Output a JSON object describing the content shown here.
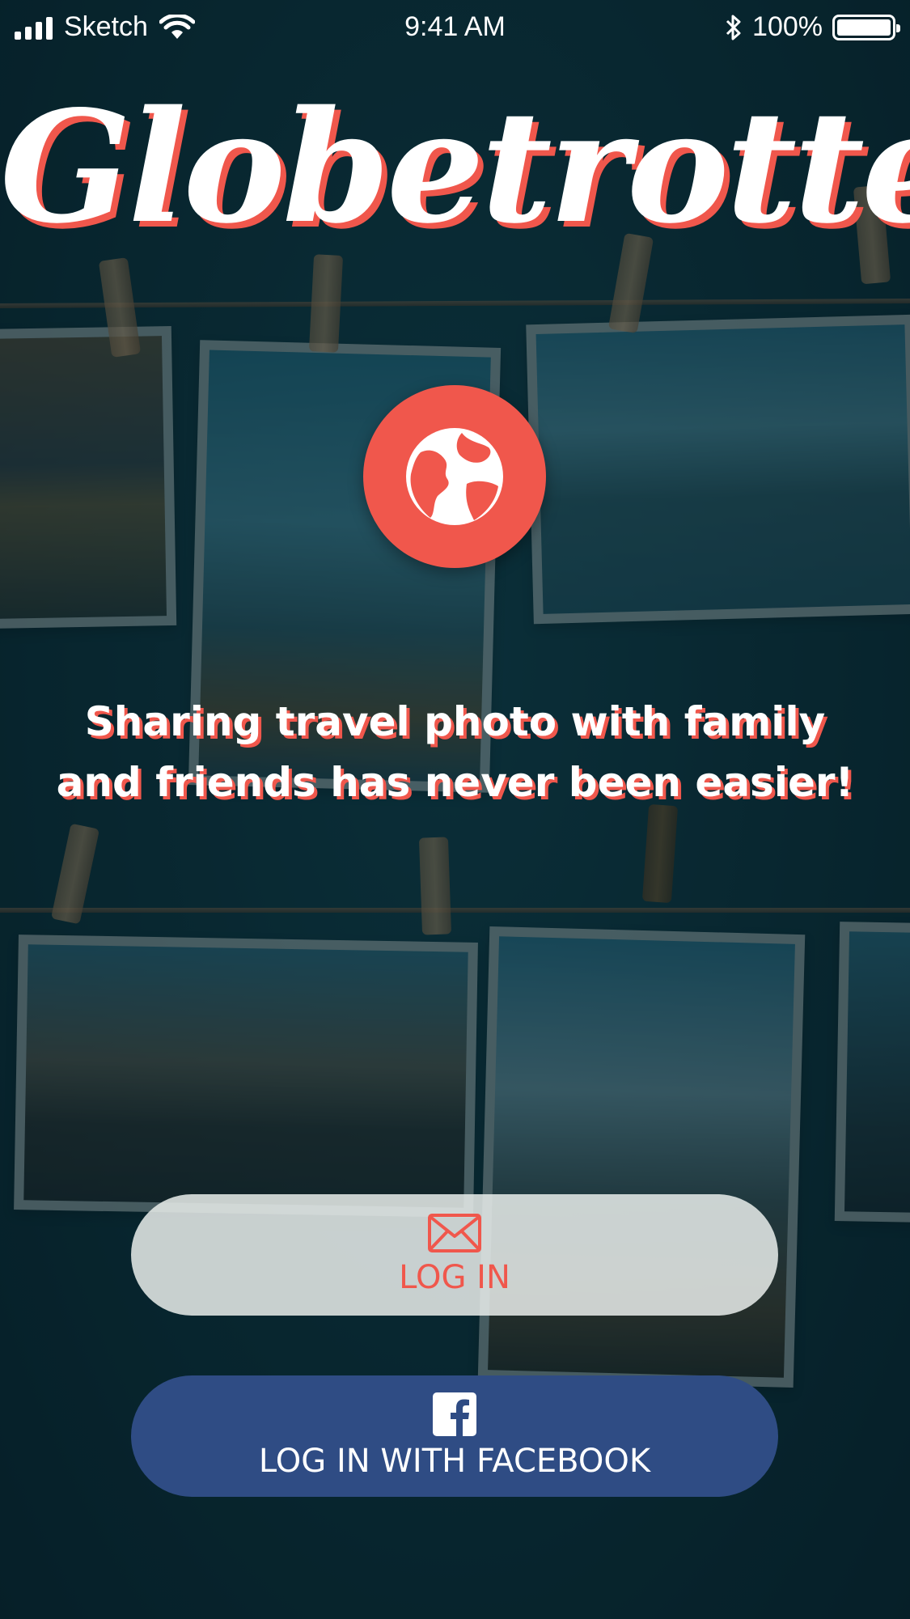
{
  "status_bar": {
    "carrier": "Sketch",
    "time": "9:41 AM",
    "battery": "100%"
  },
  "app": {
    "title": "Globetrotter",
    "tagline": "Sharing travel photo with family and friends has never been easier!"
  },
  "buttons": {
    "login_label": "LOG IN",
    "facebook_label": "LOG IN WITH FACEBOOK"
  },
  "icons": {
    "logo": "globe-icon",
    "login": "envelope-icon",
    "facebook": "facebook-icon"
  },
  "colors": {
    "accent": "#f0574c",
    "background": "#0b2a33",
    "facebook": "#2f4c84",
    "login_button": "#e8ecea"
  }
}
